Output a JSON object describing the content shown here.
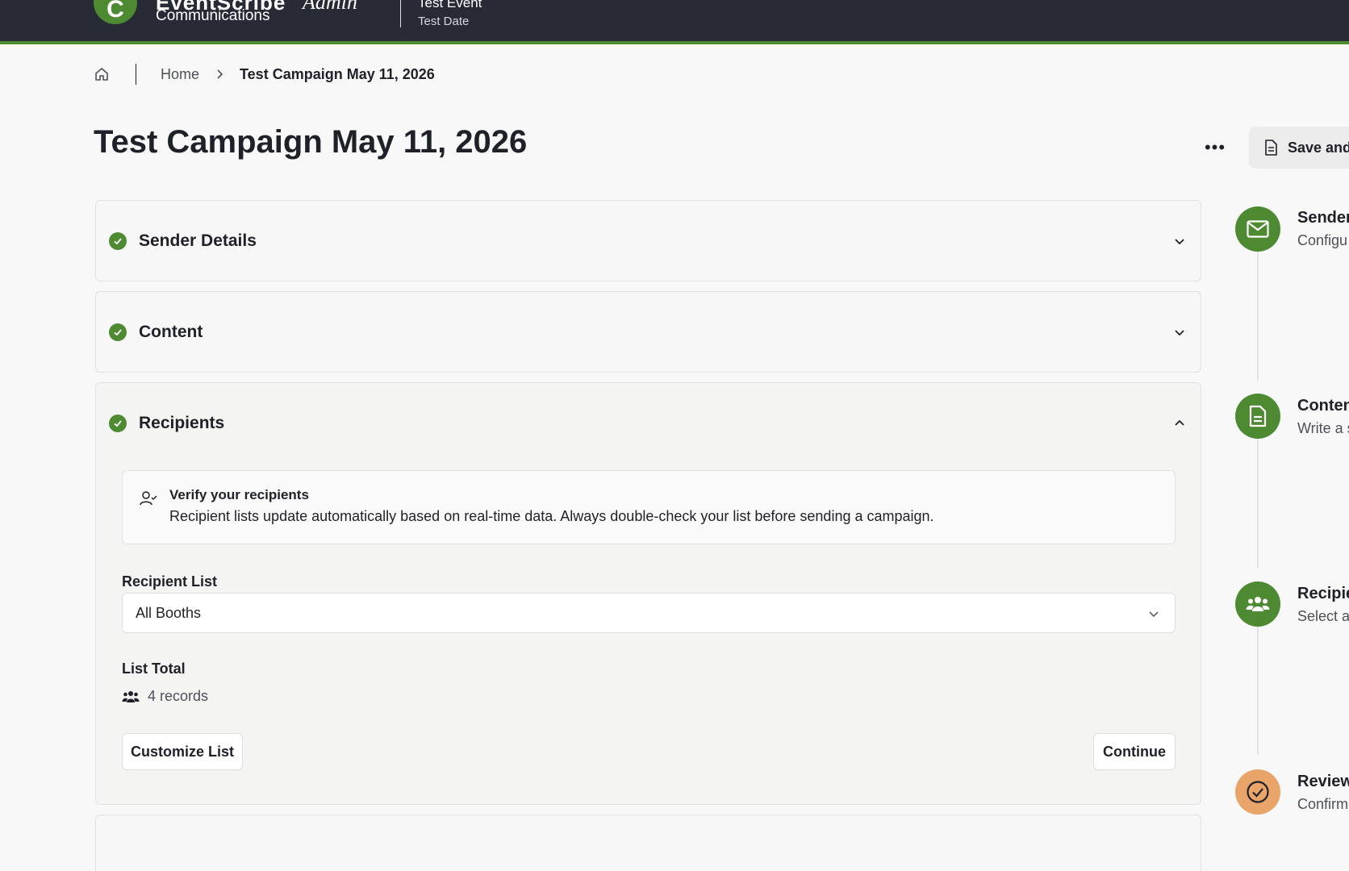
{
  "header": {
    "logo_letter": "C",
    "brand_name": "EventScribe",
    "brand_suffix": "Admin",
    "brand_sub": "Communications",
    "event_title": "Test Event",
    "event_date": "Test Date"
  },
  "breadcrumb": {
    "home_label": "Home",
    "current": "Test Campaign May 11, 2026"
  },
  "page": {
    "title": "Test Campaign May 11, 2026",
    "more_label": "•••",
    "save_label": "Save and"
  },
  "sections": [
    {
      "title": "Sender Details"
    },
    {
      "title": "Content"
    },
    {
      "title": "Recipients"
    }
  ],
  "recipients": {
    "verify_title": "Verify your recipients",
    "verify_text": "Recipient lists update automatically based on real-time data. Always double-check your list before sending a campaign.",
    "list_label": "Recipient List",
    "list_value": "All Booths",
    "total_label": "List Total",
    "total_value": "4 records",
    "customize_label": "Customize List",
    "continue_label": "Continue"
  },
  "steps": [
    {
      "title": "Sender",
      "desc": "Configu Detail",
      "icon": "envelope-icon",
      "color": "#4e8a32"
    },
    {
      "title": "Conten",
      "desc": "Write a s",
      "icon": "document-icon",
      "color": "#4e8a32"
    },
    {
      "title": "Recipie",
      "desc": "Select a",
      "icon": "users-icon",
      "color": "#4e8a32"
    },
    {
      "title": "Review",
      "desc": "Confirm a test er",
      "icon": "check-circle-icon",
      "color": "#e9a46a"
    }
  ],
  "colors": {
    "accent": "#4e8a32",
    "topbar": "#262b36",
    "review": "#e9a46a"
  }
}
